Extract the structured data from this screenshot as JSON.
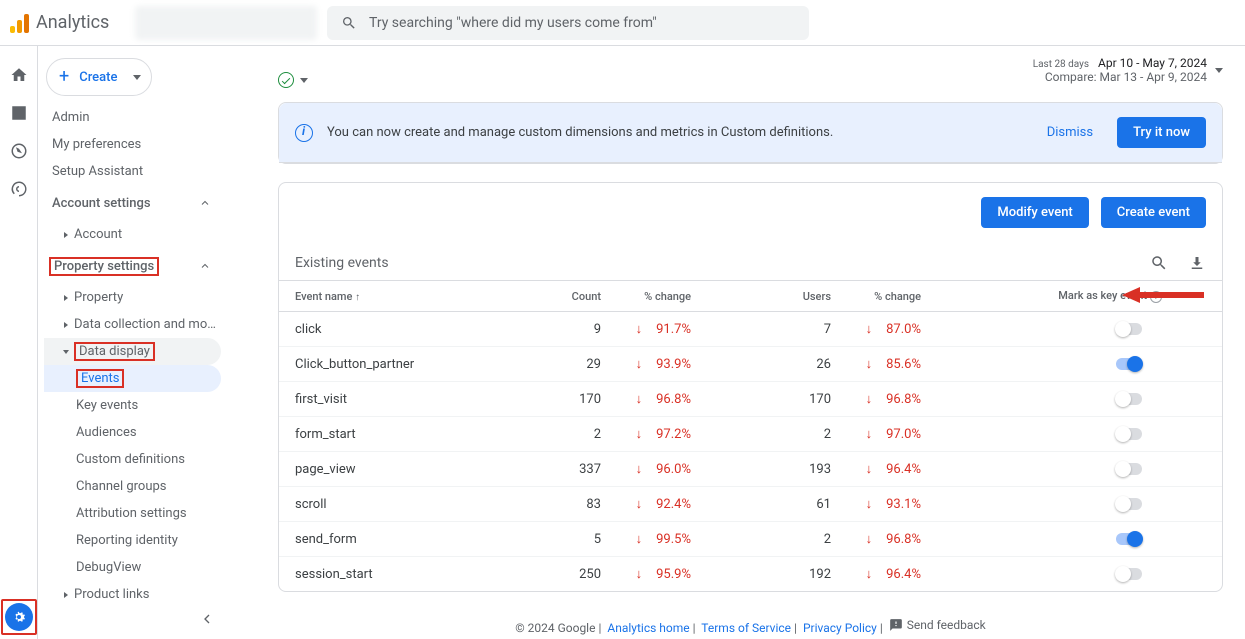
{
  "header": {
    "app_title": "Analytics",
    "search_placeholder": "Try searching \"where did my users come from\""
  },
  "sidebar": {
    "create": "Create",
    "admin": "Admin",
    "my_prefs": "My preferences",
    "setup": "Setup Assistant",
    "account_settings": "Account settings",
    "account": "Account",
    "property_settings": "Property settings",
    "property": "Property",
    "data_collection": "Data collection and modifica...",
    "data_display": "Data display",
    "events": "Events",
    "key_events": "Key events",
    "audiences": "Audiences",
    "custom_definitions": "Custom definitions",
    "channel_groups": "Channel groups",
    "attribution_settings": "Attribution settings",
    "reporting_identity": "Reporting identity",
    "debugview": "DebugView",
    "product_links": "Product links"
  },
  "date": {
    "label": "Last 28 days",
    "range": "Apr 10 - May 7, 2024",
    "compare": "Compare: Mar 13 - Apr 9, 2024"
  },
  "banner": {
    "text": "You can now create and manage custom dimensions and metrics in Custom definitions.",
    "dismiss": "Dismiss",
    "try": "Try it now"
  },
  "actions": {
    "modify": "Modify event",
    "create": "Create event"
  },
  "table": {
    "title": "Existing events",
    "cols": {
      "name": "Event name",
      "count": "Count",
      "pct1": "% change",
      "users": "Users",
      "pct2": "% change",
      "key": "Mark as key event"
    },
    "rows": [
      {
        "name": "click",
        "count": "9",
        "pct1": "91.7%",
        "users": "7",
        "pct2": "87.0%",
        "on": false
      },
      {
        "name": "Click_button_partner",
        "count": "29",
        "pct1": "93.9%",
        "users": "26",
        "pct2": "85.6%",
        "on": true
      },
      {
        "name": "first_visit",
        "count": "170",
        "pct1": "96.8%",
        "users": "170",
        "pct2": "96.8%",
        "on": false
      },
      {
        "name": "form_start",
        "count": "2",
        "pct1": "97.2%",
        "users": "2",
        "pct2": "97.0%",
        "on": false
      },
      {
        "name": "page_view",
        "count": "337",
        "pct1": "96.0%",
        "users": "193",
        "pct2": "96.4%",
        "on": false
      },
      {
        "name": "scroll",
        "count": "83",
        "pct1": "92.4%",
        "users": "61",
        "pct2": "93.1%",
        "on": false
      },
      {
        "name": "send_form",
        "count": "5",
        "pct1": "99.5%",
        "users": "2",
        "pct2": "96.8%",
        "on": true
      },
      {
        "name": "session_start",
        "count": "250",
        "pct1": "95.9%",
        "users": "192",
        "pct2": "96.4%",
        "on": false
      }
    ]
  },
  "footer": {
    "copy": "© 2024 Google",
    "home": "Analytics home",
    "terms": "Terms of Service",
    "privacy": "Privacy Policy",
    "feedback": "Send feedback"
  }
}
